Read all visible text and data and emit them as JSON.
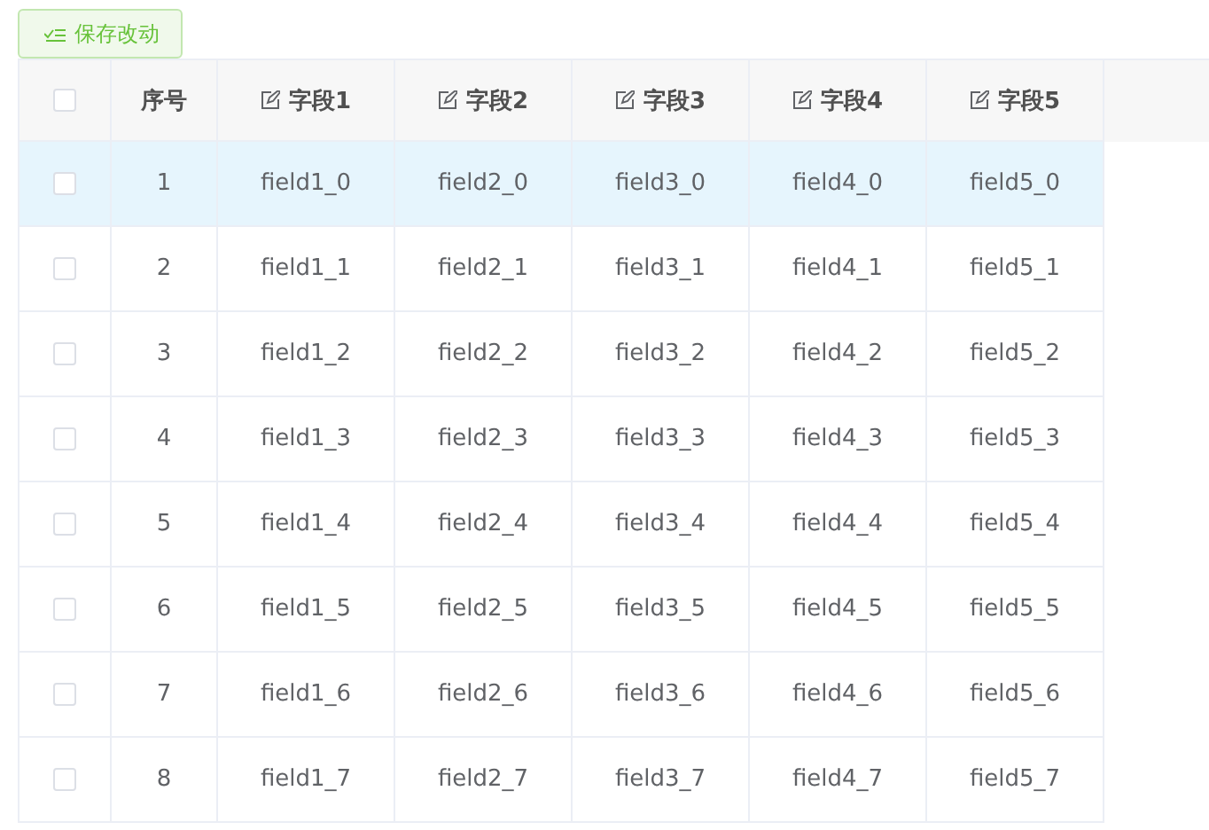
{
  "toolbar": {
    "save_button": {
      "label": "保存改动"
    }
  },
  "table": {
    "select_all_checked": false,
    "columns": [
      {
        "label": "序号",
        "editable": false
      },
      {
        "label": "字段1",
        "editable": true
      },
      {
        "label": "字段2",
        "editable": true
      },
      {
        "label": "字段3",
        "editable": true
      },
      {
        "label": "字段4",
        "editable": true
      },
      {
        "label": "字段5",
        "editable": true
      }
    ],
    "rows": [
      {
        "checked": false,
        "selected": true,
        "cells": [
          "1",
          "field1_0",
          "field2_0",
          "field3_0",
          "field4_0",
          "field5_0"
        ]
      },
      {
        "checked": false,
        "selected": false,
        "cells": [
          "2",
          "field1_1",
          "field2_1",
          "field3_1",
          "field4_1",
          "field5_1"
        ]
      },
      {
        "checked": false,
        "selected": false,
        "cells": [
          "3",
          "field1_2",
          "field2_2",
          "field3_2",
          "field4_2",
          "field5_2"
        ]
      },
      {
        "checked": false,
        "selected": false,
        "cells": [
          "4",
          "field1_3",
          "field2_3",
          "field3_3",
          "field4_3",
          "field5_3"
        ]
      },
      {
        "checked": false,
        "selected": false,
        "cells": [
          "5",
          "field1_4",
          "field2_4",
          "field3_4",
          "field4_4",
          "field5_4"
        ]
      },
      {
        "checked": false,
        "selected": false,
        "cells": [
          "6",
          "field1_5",
          "field2_5",
          "field3_5",
          "field4_5",
          "field5_5"
        ]
      },
      {
        "checked": false,
        "selected": false,
        "cells": [
          "7",
          "field1_6",
          "field2_6",
          "field3_6",
          "field4_6",
          "field5_6"
        ]
      },
      {
        "checked": false,
        "selected": false,
        "cells": [
          "8",
          "field1_7",
          "field2_7",
          "field3_7",
          "field4_7",
          "field5_7"
        ]
      }
    ]
  }
}
